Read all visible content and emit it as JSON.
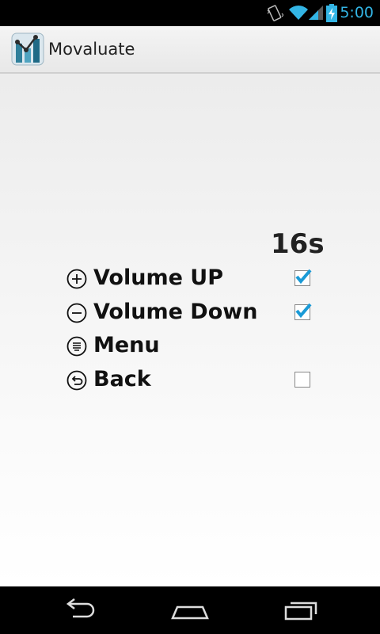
{
  "status_bar": {
    "time": "5:00",
    "icons": [
      "vibrate-icon",
      "wifi-icon",
      "signal-icon",
      "battery-charging-icon"
    ]
  },
  "action_bar": {
    "title": "Movaluate",
    "icon": "app-logo-icon"
  },
  "main": {
    "timer": "16s",
    "buttons": [
      {
        "icon": "plus-circle-icon",
        "label": "Volume UP",
        "checked": true
      },
      {
        "icon": "minus-circle-icon",
        "label": "Volume Down",
        "checked": true
      },
      {
        "icon": "menu-circle-icon",
        "label": "Menu",
        "checked": null
      },
      {
        "icon": "back-circle-icon",
        "label": "Back",
        "checked": false
      }
    ]
  },
  "nav_bar": {
    "icons": [
      "back-icon",
      "home-icon",
      "recent-apps-icon"
    ]
  },
  "colors": {
    "accent": "#33b5e5",
    "check": "#1a9ad6"
  }
}
